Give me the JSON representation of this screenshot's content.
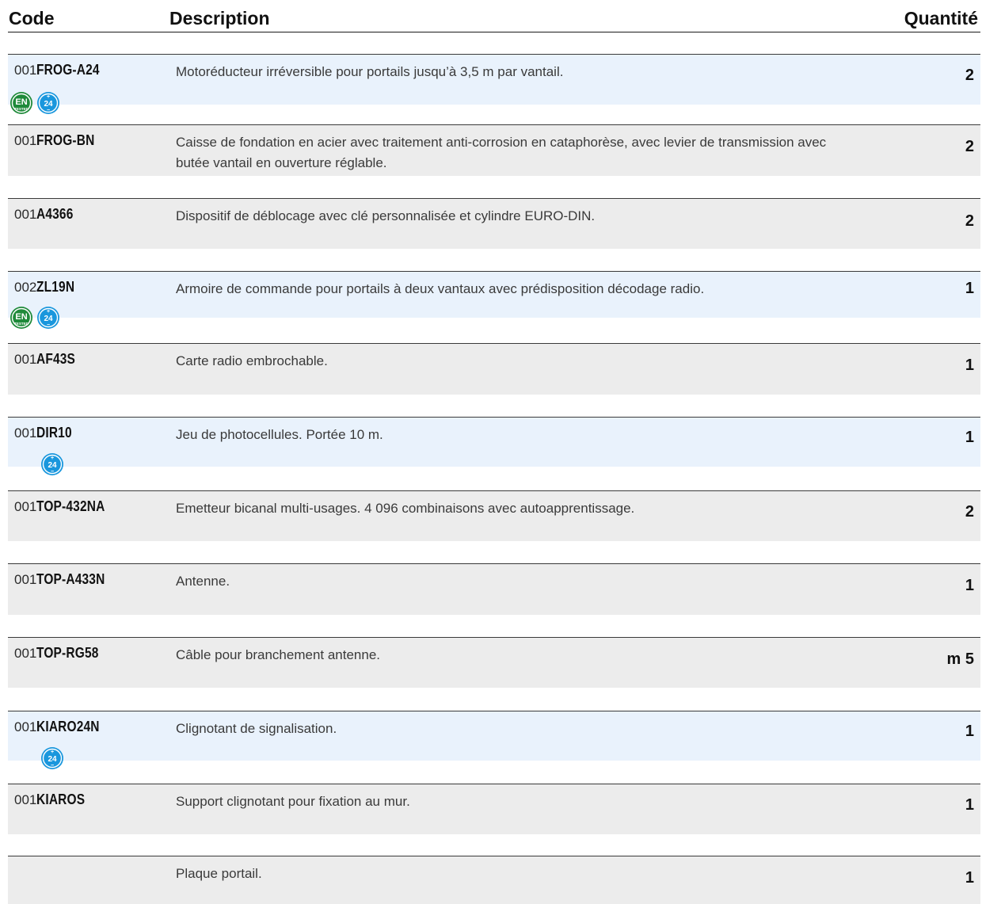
{
  "header": {
    "code": "Code",
    "description": "Description",
    "quantity": "Quantité"
  },
  "rows": [
    {
      "prefix": "001",
      "ref": "FROG-A24",
      "desc": "Motoréducteur irréversible pour portails jusqu’à 3,5 m par vantail.",
      "qty": "2"
    },
    {
      "prefix": "001",
      "ref": "FROG-BN",
      "desc": "Caisse de fondation en acier avec traitement anti-corrosion en cataphorèse, avec levier de transmission avec butée vantail en ouverture réglable.",
      "qty": "2"
    },
    {
      "prefix": "001",
      "ref": "A4366",
      "desc": "Dispositif de déblocage avec clé personnalisée et cylindre EURO-DIN.",
      "qty": "2"
    },
    {
      "prefix": "002",
      "ref": "ZL19N",
      "desc": "Armoire de commande pour portails à deux vantaux avec prédisposition décodage radio.",
      "qty": "1"
    },
    {
      "prefix": "001",
      "ref": "AF43S",
      "desc": "Carte radio embrochable.",
      "qty": "1"
    },
    {
      "prefix": "001",
      "ref": "DIR10",
      "desc": "Jeu de photocellules. Portée 10 m.",
      "qty": "1"
    },
    {
      "prefix": "001",
      "ref": "TOP-432NA",
      "desc": "Emetteur bicanal multi-usages. 4 096 combinaisons avec autoapprentissage.",
      "qty": "2"
    },
    {
      "prefix": "001",
      "ref": "TOP-A433N",
      "desc": "Antenne.",
      "qty": "1"
    },
    {
      "prefix": "001",
      "ref": "TOP-RG58",
      "desc": "Câble pour branchement antenne.",
      "qty": "m 5"
    },
    {
      "prefix": "001",
      "ref": "KIARO24N",
      "desc": "Clignotant de signalisation.",
      "qty": "1"
    },
    {
      "prefix": "001",
      "ref": "KIAROS",
      "desc": "Support clignotant pour fixation au mur.",
      "qty": "1"
    },
    {
      "prefix": "",
      "ref": "",
      "desc": "Plaque portail.",
      "qty": "1"
    }
  ],
  "badge_text": {
    "en": "EN",
    "tested": "TESTED",
    "v24": "24",
    "plus": "+",
    "minus": "−"
  },
  "colors": {
    "row_blue": "#e9f2fc",
    "row_grey": "#ececec",
    "badge_green": "#1f8a3a",
    "badge_blue": "#1a97dd"
  },
  "icons": [
    "en-tested-icon",
    "24v-icon"
  ]
}
